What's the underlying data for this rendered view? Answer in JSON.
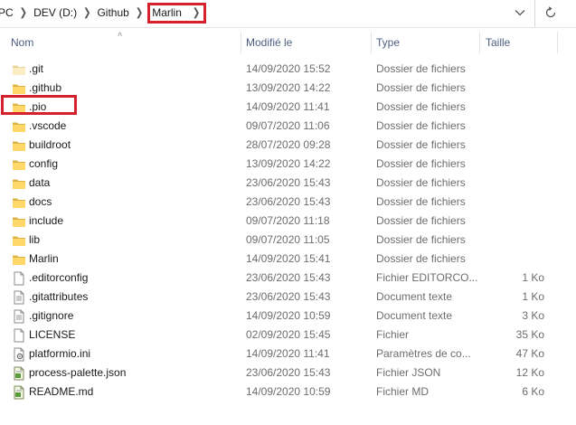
{
  "breadcrumb": {
    "items": [
      "PC",
      "DEV (D:)",
      "Github"
    ],
    "current": "Marlin"
  },
  "icons": {
    "dropdown": "chevron-down-icon",
    "refresh": "refresh-icon",
    "folder": "folder-icon",
    "file": "file-icon",
    "text_file": "text-file-icon",
    "json_file": "json-file-icon"
  },
  "columns": {
    "name": "Nom",
    "modified": "Modifié le",
    "type": "Type",
    "size": "Taille"
  },
  "highlight_color": "#d6202b",
  "files": [
    {
      "name": ".git",
      "modified": "14/09/2020 15:52",
      "type": "Dossier de fichiers",
      "size": "",
      "kind": "folder-light"
    },
    {
      "name": ".github",
      "modified": "13/09/2020 14:22",
      "type": "Dossier de fichiers",
      "size": "",
      "kind": "folder"
    },
    {
      "name": ".pio",
      "modified": "14/09/2020 11:41",
      "type": "Dossier de fichiers",
      "size": "",
      "kind": "folder"
    },
    {
      "name": ".vscode",
      "modified": "09/07/2020 11:06",
      "type": "Dossier de fichiers",
      "size": "",
      "kind": "folder"
    },
    {
      "name": "buildroot",
      "modified": "28/07/2020 09:28",
      "type": "Dossier de fichiers",
      "size": "",
      "kind": "folder"
    },
    {
      "name": "config",
      "modified": "13/09/2020 14:22",
      "type": "Dossier de fichiers",
      "size": "",
      "kind": "folder"
    },
    {
      "name": "data",
      "modified": "23/06/2020 15:43",
      "type": "Dossier de fichiers",
      "size": "",
      "kind": "folder"
    },
    {
      "name": "docs",
      "modified": "23/06/2020 15:43",
      "type": "Dossier de fichiers",
      "size": "",
      "kind": "folder"
    },
    {
      "name": "include",
      "modified": "09/07/2020 11:18",
      "type": "Dossier de fichiers",
      "size": "",
      "kind": "folder"
    },
    {
      "name": "lib",
      "modified": "09/07/2020 11:05",
      "type": "Dossier de fichiers",
      "size": "",
      "kind": "folder"
    },
    {
      "name": "Marlin",
      "modified": "14/09/2020 15:41",
      "type": "Dossier de fichiers",
      "size": "",
      "kind": "folder"
    },
    {
      "name": ".editorconfig",
      "modified": "23/06/2020 15:43",
      "type": "Fichier EDITORCO...",
      "size": "1 Ko",
      "kind": "file"
    },
    {
      "name": ".gitattributes",
      "modified": "23/06/2020 15:43",
      "type": "Document texte",
      "size": "1 Ko",
      "kind": "text"
    },
    {
      "name": ".gitignore",
      "modified": "14/09/2020 10:59",
      "type": "Document texte",
      "size": "3 Ko",
      "kind": "text"
    },
    {
      "name": "LICENSE",
      "modified": "02/09/2020 15:45",
      "type": "Fichier",
      "size": "35 Ko",
      "kind": "file"
    },
    {
      "name": "platformio.ini",
      "modified": "14/09/2020 11:41",
      "type": "Paramètres de co...",
      "size": "47 Ko",
      "kind": "ini"
    },
    {
      "name": "process-palette.json",
      "modified": "23/06/2020 15:43",
      "type": "Fichier JSON",
      "size": "12 Ko",
      "kind": "json"
    },
    {
      "name": "README.md",
      "modified": "14/09/2020 10:59",
      "type": "Fichier MD",
      "size": "6 Ko",
      "kind": "json"
    }
  ]
}
